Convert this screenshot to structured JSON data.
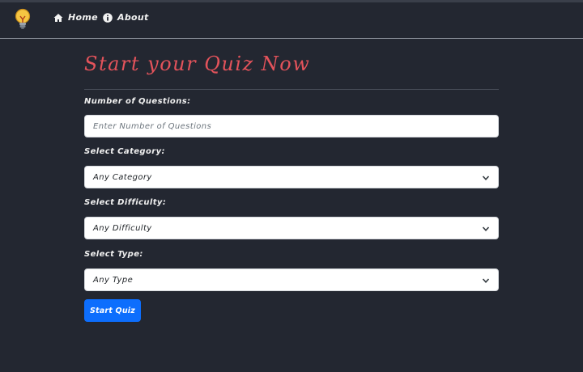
{
  "nav": {
    "logo_icon": "lightbulb-icon",
    "home_icon": "home-icon",
    "home_label": "Home",
    "about_icon": "info-icon",
    "about_label": "About"
  },
  "main": {
    "title": "Start your Quiz Now",
    "num_questions": {
      "label": "Number of Questions:",
      "placeholder": "Enter Number of Questions",
      "value": ""
    },
    "category": {
      "label": "Select Category:",
      "selected": "Any Category"
    },
    "difficulty": {
      "label": "Select Difficulty:",
      "selected": "Any Difficulty"
    },
    "type": {
      "label": "Select Type:",
      "selected": "Any Type"
    },
    "start_button": "Start Quiz"
  },
  "colors": {
    "background": "#232731",
    "title": "#e3535b",
    "button": "#0d6efd",
    "logo_bulb": "#f5c542"
  }
}
